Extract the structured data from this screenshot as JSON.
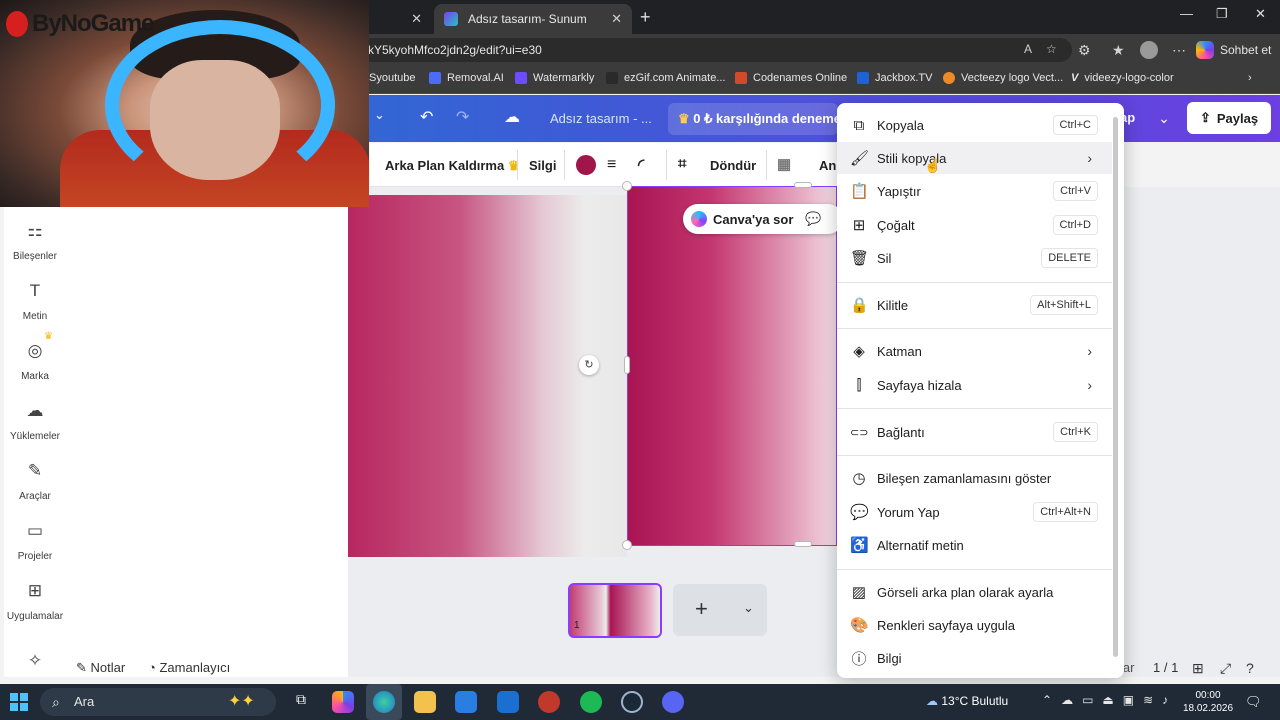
{
  "browser": {
    "inactive_tab_close": "✕",
    "active_tab": {
      "title": "Adsız tasarım- Sunum",
      "close": "✕"
    },
    "new_tab": "+",
    "url": "kY5kyohMfco2jdn2g/edit?ui=e30",
    "copilot_label": "Sohbet et",
    "bookmarks": [
      {
        "label": "Syoutube",
        "color": "#ff0000"
      },
      {
        "label": "Removal.AI",
        "color": "#4a6cf7"
      },
      {
        "label": "Watermarkly",
        "color": "#6b4dff"
      },
      {
        "label": "ezGif.com Animate...",
        "color": "#2a2a2a"
      },
      {
        "label": "Codenames Online",
        "color": "#d14b2a"
      },
      {
        "label": "Jackbox.TV",
        "color": "#1e62d6"
      },
      {
        "label": "Vecteezy logo Vect...",
        "color": "#f08a24"
      },
      {
        "label": "videezy-logo-color",
        "color": "#2a2a2a"
      }
    ]
  },
  "canva": {
    "doc_title": "Adsız tasarım - ...",
    "promo": "0 ₺ karşılığında deneme s",
    "share_label": "Paylaş",
    "partial_label": "ap",
    "toolbar": {
      "bg_remove": "Arka Plan Kaldırma",
      "eraser": "Silgi",
      "rotate": "Döndür",
      "animate": "Ani"
    },
    "ask_canva": "Canva'ya sor",
    "sidebar": [
      {
        "label": "Bileşenler",
        "icon": "⚏"
      },
      {
        "label": "Metin",
        "icon": "T"
      },
      {
        "label": "Marka",
        "icon": "◎"
      },
      {
        "label": "Yüklemeler",
        "icon": "☁"
      },
      {
        "label": "Araçlar",
        "icon": "✎"
      },
      {
        "label": "Projeler",
        "icon": "▭"
      },
      {
        "label": "Uygulamalar",
        "icon": "⊞"
      }
    ],
    "page_thumb_number": "1",
    "bottom": {
      "notes": "Notlar",
      "timer": "Zamanlayıcı",
      "partial_notes": "lar",
      "page_counter": "1 / 1"
    }
  },
  "context_menu": {
    "items": [
      {
        "label": "Kopyala",
        "shortcut": "Ctrl+C",
        "icon": "⧉"
      },
      {
        "label": "Stili kopyala",
        "arrow": "›",
        "icon": "🖌"
      },
      {
        "label": "Yapıştır",
        "shortcut": "Ctrl+V",
        "icon": "📋"
      },
      {
        "label": "Çoğalt",
        "shortcut": "Ctrl+D",
        "icon": "⊞"
      },
      {
        "label": "Sil",
        "shortcut": "DELETE",
        "icon": "🗑"
      },
      {
        "label": "Kilitle",
        "shortcut": "Alt+Shift+L",
        "icon": "🔒"
      },
      {
        "label": "Katman",
        "arrow": "›",
        "icon": "◈"
      },
      {
        "label": "Sayfaya hizala",
        "arrow": "›",
        "icon": "⫿"
      },
      {
        "label": "Bağlantı",
        "shortcut": "Ctrl+K",
        "icon": "⊂⊃"
      },
      {
        "label": "Bileşen zamanlamasını göster",
        "icon": "◷"
      },
      {
        "label": "Yorum Yap",
        "shortcut": "Ctrl+Alt+N",
        "icon": "💬"
      },
      {
        "label": "Alternatif metin",
        "icon": "♿"
      },
      {
        "label": "Görseli arka plan olarak ayarla",
        "icon": "▨"
      },
      {
        "label": "Renkleri sayfaya uygula",
        "icon": "🎨"
      },
      {
        "label": "Bilgi",
        "icon": "ⓘ"
      }
    ]
  },
  "webcam": {
    "overlay_brand": "ByNoGame"
  },
  "taskbar": {
    "search_label": "Ara",
    "weather": "13°C  Bulutlu",
    "time": "00:00",
    "date": "18.02.2026"
  }
}
